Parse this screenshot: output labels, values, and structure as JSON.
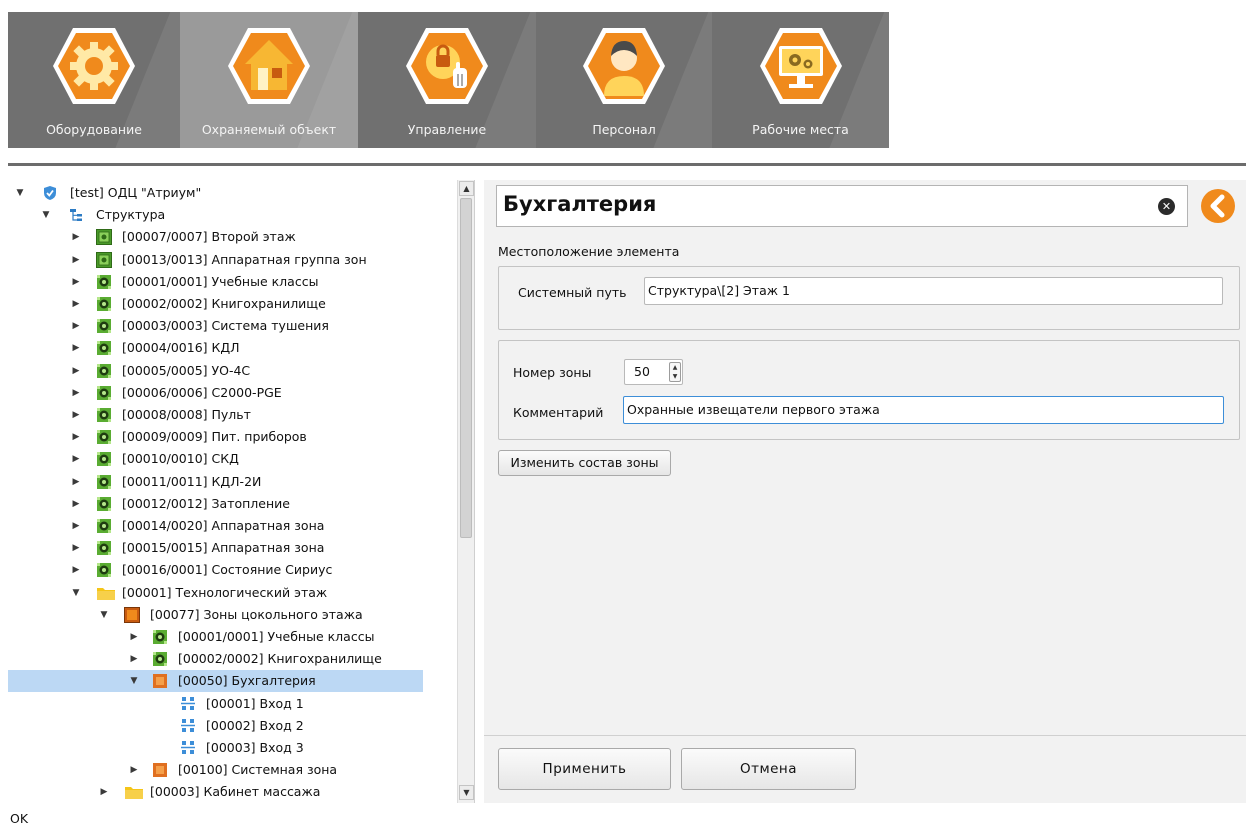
{
  "toolbar": {
    "tiles": [
      {
        "label": "Оборудование",
        "icon": "gear-icon",
        "active": false
      },
      {
        "label": "Охраняемый объект",
        "icon": "house-icon",
        "active": true
      },
      {
        "label": "Управление",
        "icon": "lock-hand-icon",
        "active": false
      },
      {
        "label": "Персонал",
        "icon": "person-icon",
        "active": false
      },
      {
        "label": "Рабочие места",
        "icon": "monitor-gears-icon",
        "active": false
      }
    ]
  },
  "colors": {
    "accent_orange": "#f08a1c",
    "toolbar_bg": "#707070",
    "toolbar_active": "#9a9a9a",
    "selection": "#bcd8f4",
    "zone_green": "#4a9a2a",
    "zone_orange": "#e07020",
    "folder_yellow": "#f5c518"
  },
  "tree": {
    "rows": [
      {
        "text": "[test] ОДЦ \"Атриум\"",
        "level": 0,
        "arrow": "expanded",
        "icon": "shield-icon"
      },
      {
        "text": "Структура",
        "level": 1,
        "arrow": "expanded",
        "icon": "structure-tree-icon"
      },
      {
        "text": "[00007/0007] Второй этаж",
        "level": 2,
        "arrow": "collapsed",
        "icon": "hardware-zone-group-icon"
      },
      {
        "text": "[00013/0013] Аппаратная группа зон",
        "level": 2,
        "arrow": "collapsed",
        "icon": "hardware-zone-group-icon"
      },
      {
        "text": "[00001/0001] Учебные классы",
        "level": 2,
        "arrow": "collapsed",
        "icon": "hardware-zone-icon"
      },
      {
        "text": "[00002/0002] Книгохранилище",
        "level": 2,
        "arrow": "collapsed",
        "icon": "hardware-zone-icon"
      },
      {
        "text": "[00003/0003] Система тушения",
        "level": 2,
        "arrow": "collapsed",
        "icon": "hardware-zone-icon"
      },
      {
        "text": "[00004/0016] КДЛ",
        "level": 2,
        "arrow": "collapsed",
        "icon": "hardware-zone-icon"
      },
      {
        "text": "[00005/0005] УО-4С",
        "level": 2,
        "arrow": "collapsed",
        "icon": "hardware-zone-icon"
      },
      {
        "text": "[00006/0006] С2000-PGE",
        "level": 2,
        "arrow": "collapsed",
        "icon": "hardware-zone-icon"
      },
      {
        "text": "[00008/0008] Пульт",
        "level": 2,
        "arrow": "collapsed",
        "icon": "hardware-zone-icon"
      },
      {
        "text": "[00009/0009] Пит. приборов",
        "level": 2,
        "arrow": "collapsed",
        "icon": "hardware-zone-icon"
      },
      {
        "text": "[00010/0010] СКД",
        "level": 2,
        "arrow": "collapsed",
        "icon": "hardware-zone-icon"
      },
      {
        "text": "[00011/0011] КДЛ-2И",
        "level": 2,
        "arrow": "collapsed",
        "icon": "hardware-zone-icon"
      },
      {
        "text": "[00012/0012] Затопление",
        "level": 2,
        "arrow": "collapsed",
        "icon": "hardware-zone-icon"
      },
      {
        "text": "[00014/0020] Аппаратная зона",
        "level": 2,
        "arrow": "collapsed",
        "icon": "hardware-zone-icon"
      },
      {
        "text": "[00015/0015] Аппаратная зона",
        "level": 2,
        "arrow": "collapsed",
        "icon": "hardware-zone-icon"
      },
      {
        "text": "[00016/0001] Состояние Сириус",
        "level": 2,
        "arrow": "collapsed",
        "icon": "hardware-zone-icon"
      },
      {
        "text": "[00001] Технологический этаж",
        "level": 2,
        "arrow": "expanded",
        "icon": "folder-icon"
      },
      {
        "text": "[00077] Зоны цокольного этажа",
        "level": 3,
        "arrow": "expanded",
        "icon": "zone-group-icon"
      },
      {
        "text": "[00001/0001] Учебные классы",
        "level": 4,
        "arrow": "collapsed",
        "icon": "hardware-zone-icon"
      },
      {
        "text": "[00002/0002] Книгохранилище",
        "level": 4,
        "arrow": "collapsed",
        "icon": "hardware-zone-icon"
      },
      {
        "text": "[00050] Бухгалтерия",
        "level": 4,
        "arrow": "expanded",
        "icon": "zone-icon",
        "selected": true
      },
      {
        "text": "[00001] Вход 1",
        "level": 5,
        "arrow": "none",
        "icon": "input-icon"
      },
      {
        "text": "[00002] Вход 2",
        "level": 5,
        "arrow": "none",
        "icon": "input-icon"
      },
      {
        "text": "[00003] Вход 3",
        "level": 5,
        "arrow": "none",
        "icon": "input-icon"
      },
      {
        "text": "[00100] Системная зона",
        "level": 4,
        "arrow": "collapsed",
        "icon": "zone-icon"
      },
      {
        "text": "[00003] Кабинет массажа",
        "level": 3,
        "arrow": "collapsed",
        "icon": "folder-icon"
      }
    ]
  },
  "details": {
    "title": "Бухгалтерия",
    "section_label": "Местоположение элемента",
    "system_path_label": "Системный путь",
    "system_path_value": "Структура\\[2] Этаж 1",
    "zone_number_label": "Номер зоны",
    "zone_number_value": "50",
    "comment_label": "Комментарий",
    "comment_value": "Охранные извещатели первого этажа",
    "change_zone_button": "Изменить состав зоны",
    "apply_button": "Применить",
    "cancel_button": "Отмена"
  },
  "status": {
    "text": "OK"
  }
}
